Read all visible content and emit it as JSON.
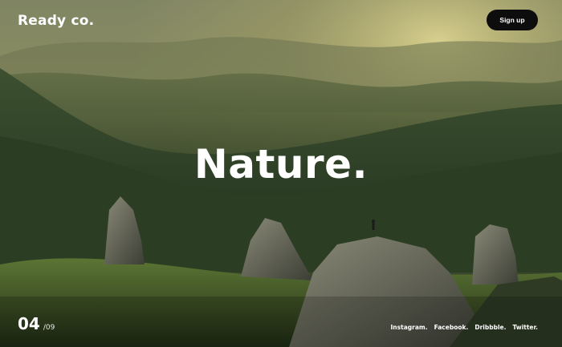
{
  "header": {
    "brand": "Ready co.",
    "signup_label": "Sign up"
  },
  "hero": {
    "headline": "Nature."
  },
  "slider": {
    "current": "04",
    "total": "/09"
  },
  "social": {
    "links": [
      "Instagram.",
      "Facebook.",
      "Dribbble.",
      "Twitter."
    ]
  },
  "colors": {
    "button_bg": "#0d0d0d",
    "text": "#ffffff",
    "sky_glow": "#c9c27a",
    "forest_dark": "#1f2c1a"
  }
}
